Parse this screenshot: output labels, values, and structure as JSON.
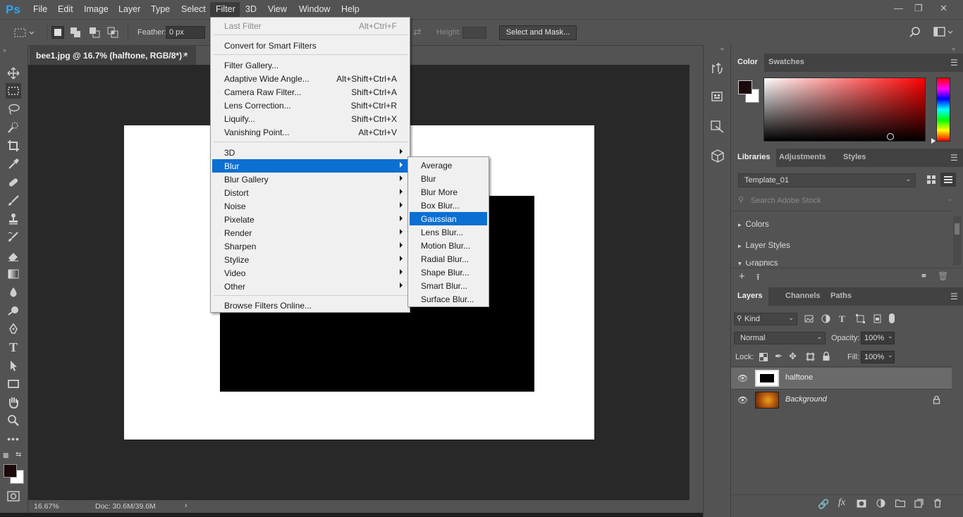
{
  "app": {
    "logo": "Ps"
  },
  "menubar": [
    "File",
    "Edit",
    "Image",
    "Layer",
    "Type",
    "Select",
    "Filter",
    "3D",
    "View",
    "Window",
    "Help"
  ],
  "options": {
    "feather_label": "Feather:",
    "feather_value": "0 px",
    "height_label": "Height:",
    "select_mask": "Select and Mask..."
  },
  "document": {
    "tab_title": "bee1.jpg @ 16.7% (halftone, RGB/8*) *",
    "zoom": "16.67%",
    "doc_info": "Doc: 30.6M/39.6M"
  },
  "filter_menu": {
    "last_filter": {
      "label": "Last Filter",
      "shortcut": "Alt+Ctrl+F"
    },
    "convert": "Convert for Smart Filters",
    "group1": [
      {
        "label": "Filter Gallery...",
        "shortcut": ""
      },
      {
        "label": "Adaptive Wide Angle...",
        "shortcut": "Alt+Shift+Ctrl+A"
      },
      {
        "label": "Camera Raw Filter...",
        "shortcut": "Shift+Ctrl+A"
      },
      {
        "label": "Lens Correction...",
        "shortcut": "Shift+Ctrl+R"
      },
      {
        "label": "Liquify...",
        "shortcut": "Shift+Ctrl+X"
      },
      {
        "label": "Vanishing Point...",
        "shortcut": "Alt+Ctrl+V"
      }
    ],
    "group2": [
      "3D",
      "Blur",
      "Blur Gallery",
      "Distort",
      "Noise",
      "Pixelate",
      "Render",
      "Sharpen",
      "Stylize",
      "Video",
      "Other"
    ],
    "browse": "Browse Filters Online..."
  },
  "blur_menu": [
    "Average",
    "Blur",
    "Blur More",
    "Box Blur...",
    "Gaussian Blur...",
    "Lens Blur...",
    "Motion Blur...",
    "Radial Blur...",
    "Shape Blur...",
    "Smart Blur...",
    "Surface Blur..."
  ],
  "color_panel": {
    "tabs": [
      "Color",
      "Swatches"
    ],
    "foreground": "#1a0a0a",
    "background": "#ffffff"
  },
  "libraries_panel": {
    "tabs": [
      "Libraries",
      "Adjustments",
      "Styles"
    ],
    "library": "Template_01",
    "search_placeholder": "Search Adobe Stock",
    "items": [
      "Colors",
      "Layer Styles",
      "Graphics"
    ]
  },
  "layers_panel": {
    "tabs": [
      "Layers",
      "Channels",
      "Paths"
    ],
    "kind": "Kind",
    "blend_mode": "Normal",
    "opacity_label": "Opacity:",
    "opacity": "100%",
    "lock_label": "Lock:",
    "fill_label": "Fill:",
    "fill": "100%",
    "layers": [
      {
        "name": "halftone"
      },
      {
        "name": "Background"
      }
    ]
  }
}
